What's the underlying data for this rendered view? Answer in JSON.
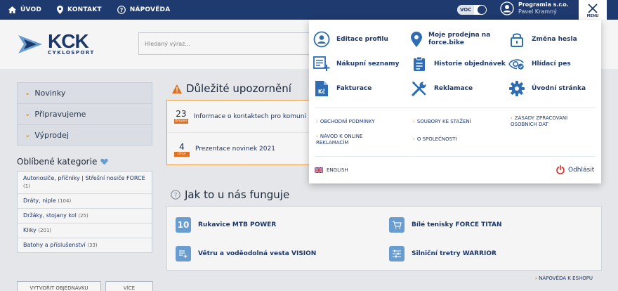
{
  "topbar": {
    "home": "ÚVOD",
    "contact": "KONTAKT",
    "help": "NÁPOVĚDA",
    "voc": "VOC",
    "user_company": "Programia s.r.o.",
    "user_name": "Pavel Kramný",
    "menu_label": "MENU"
  },
  "header": {
    "logo_main": "KCK",
    "logo_sub": "CYKLOSPORT",
    "search_placeholder": "Hledaný výraz..."
  },
  "sidebar": {
    "accordion": [
      "Novinky",
      "Připravujeme",
      "Výprodej"
    ],
    "favorites_title": "Oblíbené kategorie",
    "favorites": [
      {
        "label": "Autonosiče, příčníky | Střešní nosiče FORCE",
        "count": "(1)"
      },
      {
        "label": "Dráty, niple",
        "count": "(104)"
      },
      {
        "label": "Držáky, stojany kol",
        "count": "(25)"
      },
      {
        "label": "Kliky",
        "count": "(201)"
      },
      {
        "label": "Batohy a příslušenství",
        "count": "(33)"
      }
    ],
    "buttons": [
      "VYTVOŘIT OBJEDNÁVKU",
      "VÍCE"
    ]
  },
  "important": {
    "title": "Důležité upozornění",
    "items": [
      {
        "day": "23",
        "month": "Březen",
        "text": "Informace o kontaktech pro komunikaci"
      },
      {
        "day": "4",
        "month": "Únor",
        "text": "Prezentace novinek 2021"
      }
    ]
  },
  "how": {
    "title": "Jak to u nás funguje",
    "items": [
      {
        "label": "Rukavice MTB POWER",
        "icon": "10"
      },
      {
        "label": "Bílé tenisky FORCE TITAN",
        "icon": "cart-icon"
      },
      {
        "label": "Větru a voděodolná vesta VISION",
        "icon": "list-icon"
      },
      {
        "label": "Silniční tretry WARRIOR",
        "icon": "sliders-icon"
      }
    ],
    "help_link": "NÁPOVĚDA K ESHOPU"
  },
  "menu": {
    "items": [
      {
        "label": "Editace profilu",
        "icon": "user-icon"
      },
      {
        "label": "Moje prodejna na force.bike",
        "icon": "location-icon"
      },
      {
        "label": "Změna hesla",
        "icon": "lock-icon"
      },
      {
        "label": "Nákupní seznamy",
        "icon": "list-add-icon"
      },
      {
        "label": "Historie objednávek",
        "icon": "clipboard-icon"
      },
      {
        "label": "Hlídací pes",
        "icon": "eye-icon"
      },
      {
        "label": "Fakturace",
        "icon": "invoice-icon"
      },
      {
        "label": "Reklamace",
        "icon": "tools-icon"
      },
      {
        "label": "Úvodní stránka",
        "icon": "gear-icon"
      }
    ],
    "links": [
      "OBCHODNÍ PODMÍNKY",
      "SOUBORY KE STAŽENÍ",
      "ZÁSADY ZPRACOVÁNÍ OSOBNÍCH DAT",
      "NÁVOD K ONLINE REKLAMACÍM",
      "O SPOLEČNOSTI"
    ],
    "language": "ENGLISH",
    "logout": "Odhlásit"
  },
  "colors": {
    "navy": "#1e3a6e",
    "orange": "#e87722",
    "red": "#e2251b",
    "icon_blue": "#2e6db4"
  }
}
